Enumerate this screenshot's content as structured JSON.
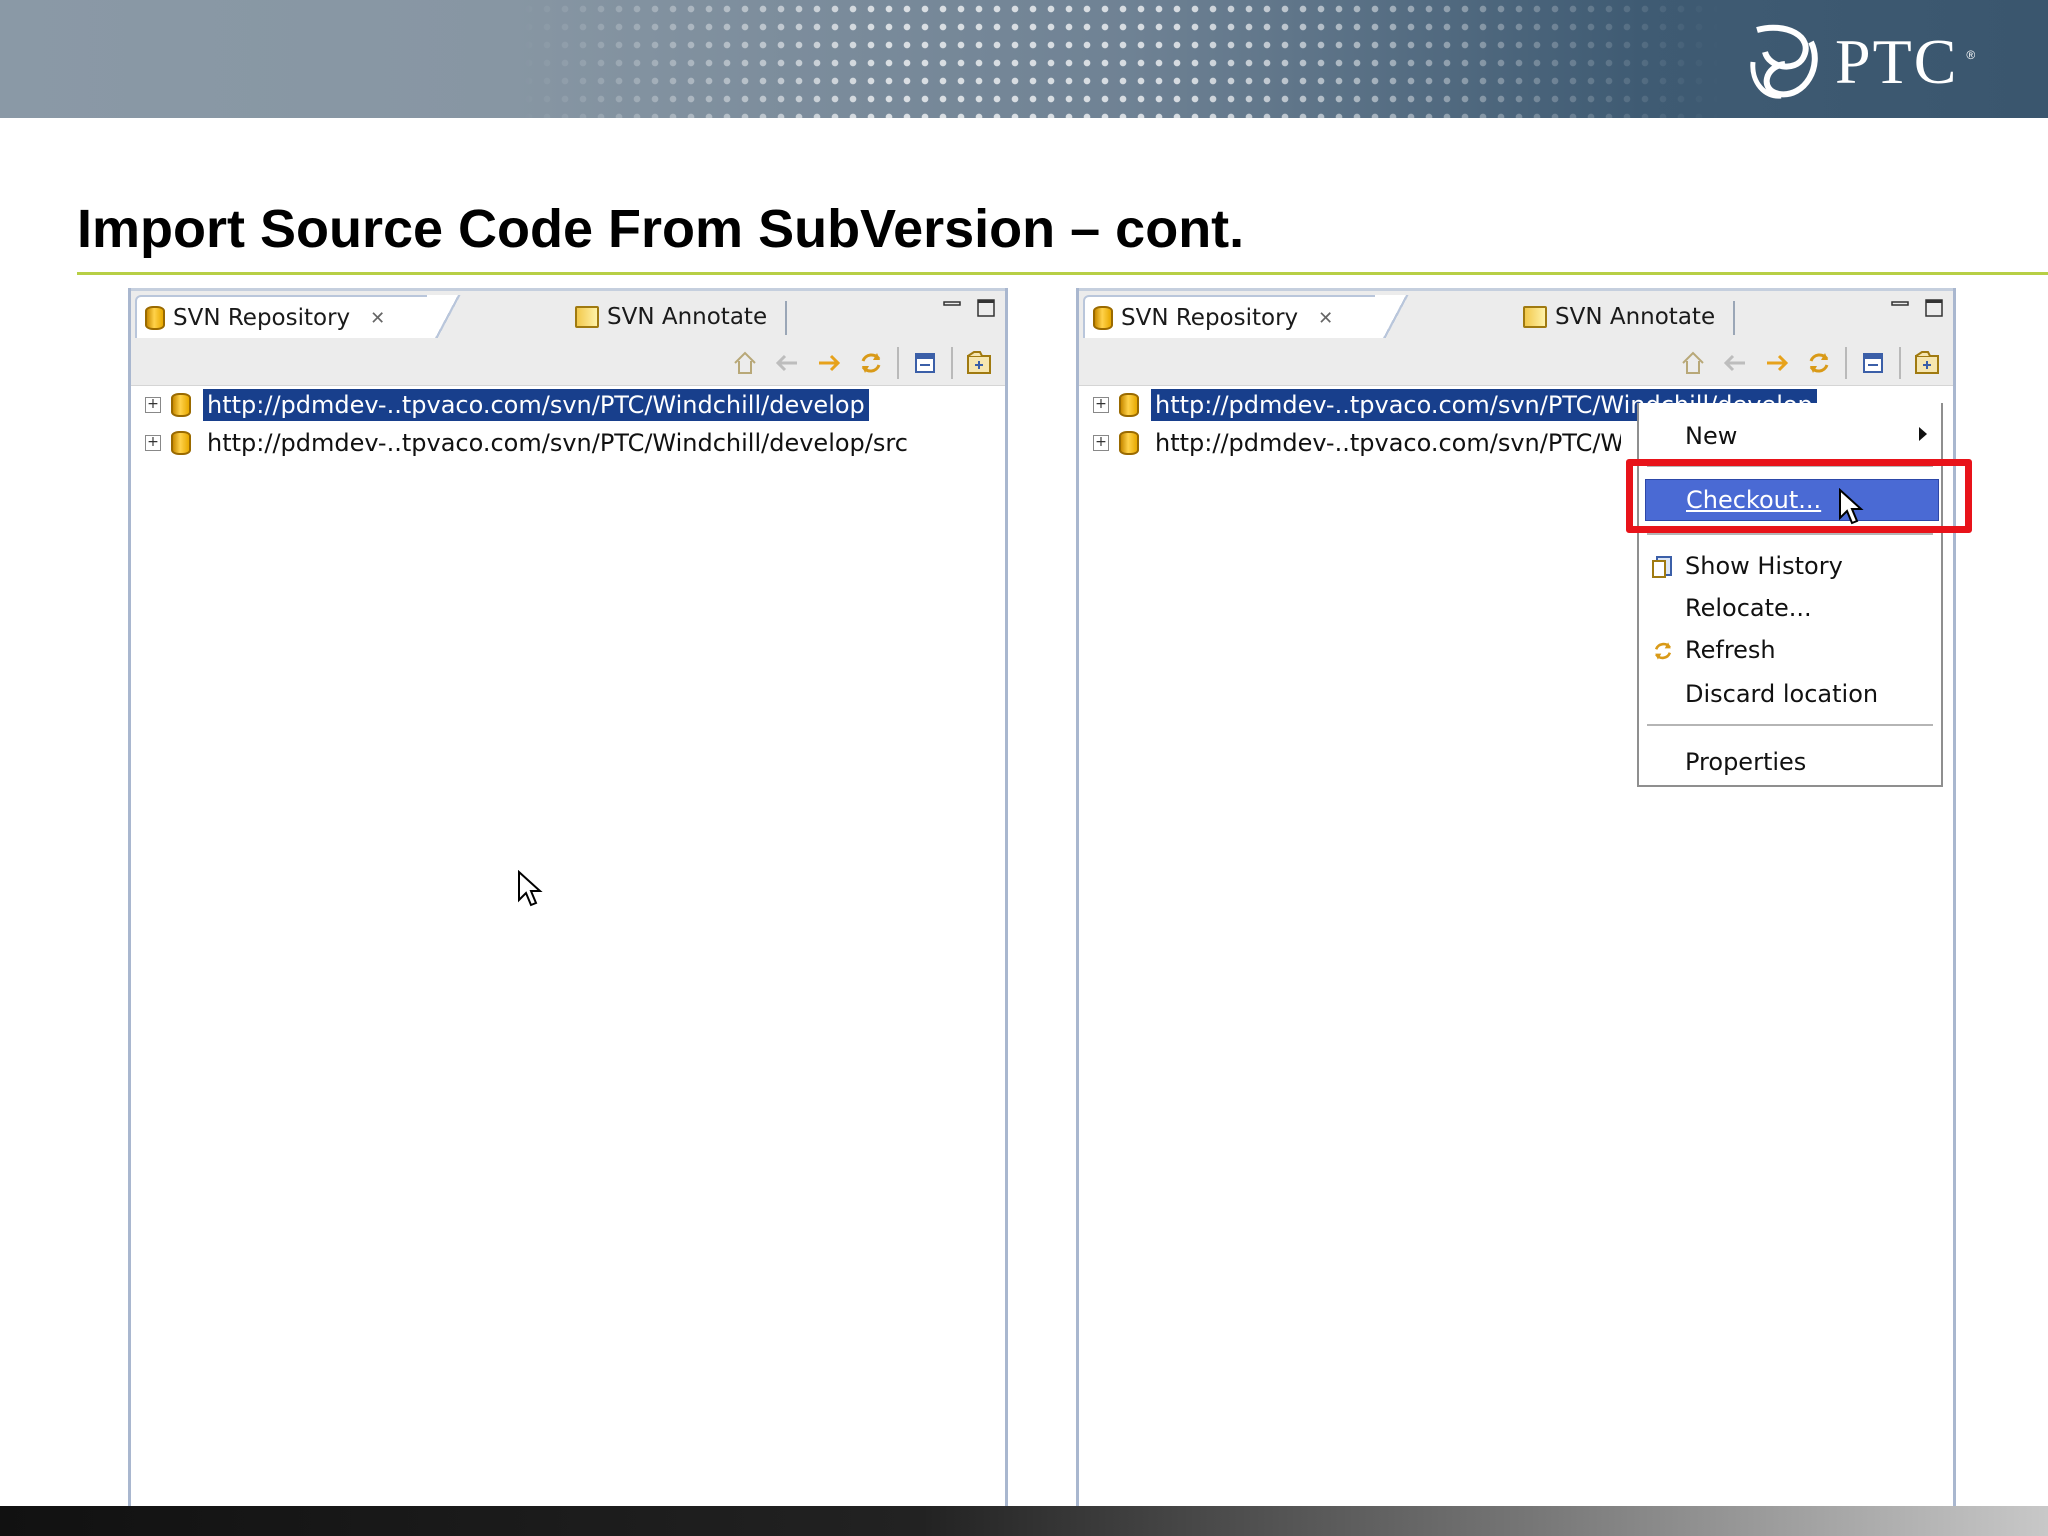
{
  "slide": {
    "title": "Import Source Code From SubVersion – cont.",
    "logo_text": "PTC",
    "logo_reg": "®"
  },
  "colors": {
    "accent_rule": "#b7cf45",
    "selection": "#183f8c",
    "menu_highlight": "#4a6ad4",
    "callout": "#e8131a"
  },
  "panels": [
    {
      "tabs": [
        {
          "label": "SVN Repository",
          "icon": "svn-repository-icon",
          "closable": true,
          "active": true
        },
        {
          "label": "SVN Annotate",
          "icon": "svn-annotate-icon",
          "active": false
        }
      ],
      "tree": [
        {
          "url": "http://pdmdev-..tpvaco.com/svn/PTC/Windchill/develop",
          "selected": true,
          "expander": "+"
        },
        {
          "url": "http://pdmdev-..tpvaco.com/svn/PTC/Windchill/develop/src",
          "selected": false,
          "expander": "+"
        }
      ]
    },
    {
      "tabs": [
        {
          "label": "SVN Repository",
          "icon": "svn-repository-icon",
          "closable": true,
          "active": true
        },
        {
          "label": "SVN Annotate",
          "icon": "svn-annotate-icon",
          "active": false
        }
      ],
      "tree": [
        {
          "url": "http://pdmdev-..tpvaco.com/svn/PTC/Windchill/develop",
          "selected": true,
          "expander": "+"
        },
        {
          "url": "http://pdmdev-..tpvaco.com/svn/PTC/Windchill/develop/src",
          "selected": false,
          "expander": "+"
        }
      ]
    }
  ],
  "toolbar_icons": [
    "go-home-icon",
    "back-icon",
    "forward-icon",
    "refresh-icon",
    "collapse-all-icon",
    "new-repository-icon"
  ],
  "context_menu": {
    "items": [
      {
        "label": "New",
        "submenu": true
      },
      {
        "label": "Checkout...",
        "highlighted": true
      },
      {
        "label": "Show History",
        "icon": "history-icon"
      },
      {
        "label": "Relocate..."
      },
      {
        "label": "Refresh",
        "icon": "refresh-icon"
      },
      {
        "label": "Discard location"
      },
      {
        "label": "Properties"
      }
    ]
  }
}
